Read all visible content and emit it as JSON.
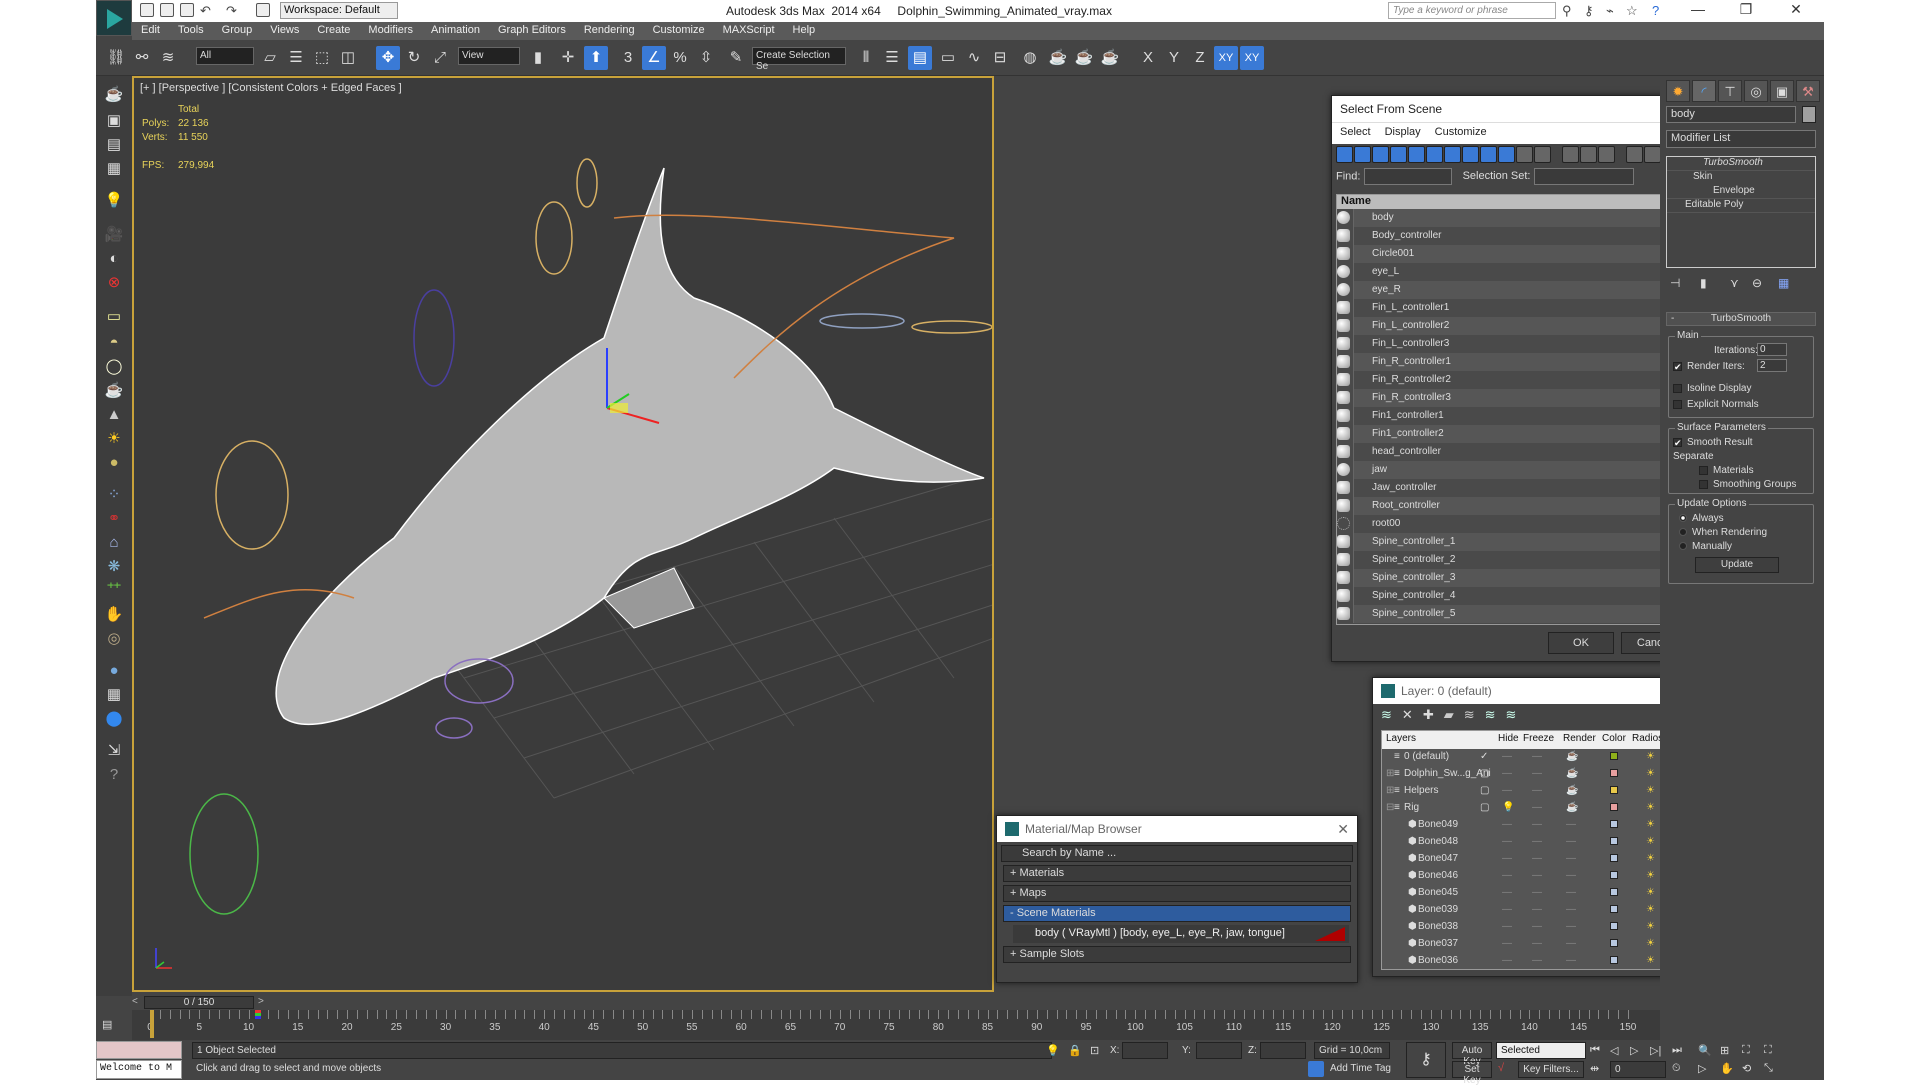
{
  "app": {
    "title": "Autodesk 3ds Max  2014 x64     Dolphin_Swimming_Animated_vray.max",
    "workspace": "Workspace: Default",
    "search_placeholder": "Type a keyword or phrase",
    "window_controls": [
      "minimize-icon",
      "maximize-icon",
      "close-icon"
    ]
  },
  "menu": [
    "Edit",
    "Tools",
    "Group",
    "Views",
    "Create",
    "Modifiers",
    "Animation",
    "Graph Editors",
    "Rendering",
    "Customize",
    "MAXScript",
    "Help"
  ],
  "toolbar": {
    "selection_filter": "All",
    "reference_coord": "View",
    "named_selection": "Create Selection Se",
    "axis_labels": [
      "X",
      "Y",
      "Z",
      "XY",
      "XY"
    ]
  },
  "viewport": {
    "label": "[+ ] [Perspective ] [Consistent Colors + Edged Faces ]",
    "stats": {
      "header": "Total",
      "polys_label": "Polys:",
      "polys": "22 136",
      "verts_label": "Verts:",
      "verts": "11 550",
      "fps_label": "FPS:",
      "fps": "279,994"
    }
  },
  "select_from_scene": {
    "title": "Select From Scene",
    "menu": [
      "Select",
      "Display",
      "Customize"
    ],
    "find_label": "Find:",
    "find_value": "",
    "selection_set_label": "Selection Set:",
    "column_name": "Name",
    "items": [
      {
        "name": "body",
        "type": "geometry"
      },
      {
        "name": "Body_controller",
        "type": "shape"
      },
      {
        "name": "Circle001",
        "type": "shape"
      },
      {
        "name": "eye_L",
        "type": "geometry"
      },
      {
        "name": "eye_R",
        "type": "geometry"
      },
      {
        "name": "Fin_L_controller1",
        "type": "shape"
      },
      {
        "name": "Fin_L_controller2",
        "type": "shape"
      },
      {
        "name": "Fin_L_controller3",
        "type": "shape"
      },
      {
        "name": "Fin_R_controller1",
        "type": "shape"
      },
      {
        "name": "Fin_R_controller2",
        "type": "shape"
      },
      {
        "name": "Fin_R_controller3",
        "type": "shape"
      },
      {
        "name": "Fin1_controller1",
        "type": "shape"
      },
      {
        "name": "Fin1_controller2",
        "type": "shape"
      },
      {
        "name": "head_controller",
        "type": "shape"
      },
      {
        "name": "jaw",
        "type": "geometry"
      },
      {
        "name": "Jaw_controller",
        "type": "shape"
      },
      {
        "name": "Root_controller",
        "type": "shape"
      },
      {
        "name": "root00",
        "type": "bone"
      },
      {
        "name": "Spine_controller_1",
        "type": "shape"
      },
      {
        "name": "Spine_controller_2",
        "type": "shape"
      },
      {
        "name": "Spine_controller_3",
        "type": "shape"
      },
      {
        "name": "Spine_controller_4",
        "type": "shape"
      },
      {
        "name": "Spine_controller_5",
        "type": "shape"
      }
    ],
    "ok_label": "OK",
    "cancel_label": "Cancel"
  },
  "layer_manager": {
    "title": "Layer: 0 (default)",
    "help": "?",
    "columns": [
      "Layers",
      "Hide",
      "Freeze",
      "Render",
      "Color",
      "Radiosity"
    ],
    "rows": [
      {
        "name": "0 (default)",
        "current": true,
        "color": "#8fb01a",
        "indent": 0
      },
      {
        "name": "Dolphin_Sw...g_Ani",
        "expand": "+",
        "color": "#e8a0a0",
        "indent": 0
      },
      {
        "name": "Helpers",
        "expand": "+",
        "color": "#e8c84a",
        "indent": 0
      },
      {
        "name": "Rig",
        "expand": "-",
        "color": "#e8a0a0",
        "hidden_bulb": true,
        "indent": 0
      },
      {
        "name": "Bone049",
        "color": "#b8c8e0",
        "indent": 1
      },
      {
        "name": "Bone048",
        "color": "#b8c8e0",
        "indent": 1
      },
      {
        "name": "Bone047",
        "color": "#b8c8e0",
        "indent": 1
      },
      {
        "name": "Bone046",
        "color": "#b8c8e0",
        "indent": 1
      },
      {
        "name": "Bone045",
        "color": "#b8c8e0",
        "indent": 1
      },
      {
        "name": "Bone039",
        "color": "#b8c8e0",
        "indent": 1
      },
      {
        "name": "Bone038",
        "color": "#b8c8e0",
        "indent": 1
      },
      {
        "name": "Bone037",
        "color": "#b8c8e0",
        "indent": 1
      },
      {
        "name": "Bone036",
        "color": "#b8c8e0",
        "indent": 1
      }
    ]
  },
  "material_browser": {
    "title": "Material/Map Browser",
    "search_placeholder": "Search by Name ...",
    "categories": [
      {
        "label": "+ Materials",
        "open": false
      },
      {
        "label": "+ Maps",
        "open": false
      },
      {
        "label": "- Scene Materials",
        "open": true
      }
    ],
    "scene_material": "body  ( VRayMtl )  [body, eye_L, eye_R, jaw, tongue]",
    "scene_material_color": "#b00000",
    "sample_slots": "+ Sample Slots"
  },
  "command_panel": {
    "object_name": "body",
    "object_color": "#a0a0a0",
    "modifier_list": "Modifier List",
    "stack": [
      {
        "label": "TurboSmooth",
        "italic": true
      },
      {
        "label": "Skin",
        "expand": "-"
      },
      {
        "label": "Envelope",
        "sub": true
      },
      {
        "label": "Editable Poly",
        "expand": "+"
      }
    ],
    "rollout_title": "TurboSmooth",
    "main_label": "Main",
    "iterations_label": "Iterations:",
    "iterations": "0",
    "render_iters_label": "Render Iters:",
    "render_iters": "2",
    "render_iters_checked": true,
    "isoline_label": "Isoline Display",
    "isoline_checked": false,
    "explicit_normals_label": "Explicit Normals",
    "explicit_normals_checked": false,
    "surface_label": "Surface Parameters",
    "smooth_result_label": "Smooth Result",
    "smooth_result_checked": true,
    "separate_label": "Separate",
    "materials_label": "Materials",
    "smoothing_groups_label": "Smoothing Groups",
    "update_options_label": "Update Options",
    "update_always": "Always",
    "update_rendering": "When Rendering",
    "update_manually": "Manually",
    "update_selected": "Always",
    "update_button": "Update"
  },
  "timeline": {
    "current_frame": 0,
    "total_frames": 150,
    "slider_label": "0 / 150",
    "tick_labels": [
      0,
      5,
      10,
      15,
      20,
      25,
      30,
      35,
      40,
      45,
      50,
      55,
      60,
      65,
      70,
      75,
      80,
      85,
      90,
      95,
      100,
      105,
      110,
      115,
      120,
      125,
      130,
      135,
      140,
      145,
      150
    ],
    "key_frame": 11
  },
  "status": {
    "maxscript_listener": "Welcome to M",
    "selection": "1 Object Selected",
    "prompt": "Click and drag to select and move objects",
    "x_label": "X:",
    "y_label": "Y:",
    "z_label": "Z:",
    "x": "",
    "y": "",
    "z": "",
    "grid": "Grid = 10,0cm",
    "add_time_tag": "Add Time Tag",
    "auto_key": "Auto Key",
    "set_key": "Set Key",
    "key_mode": "Selected",
    "key_filters": "Key Filters...",
    "frame_field": "0"
  }
}
